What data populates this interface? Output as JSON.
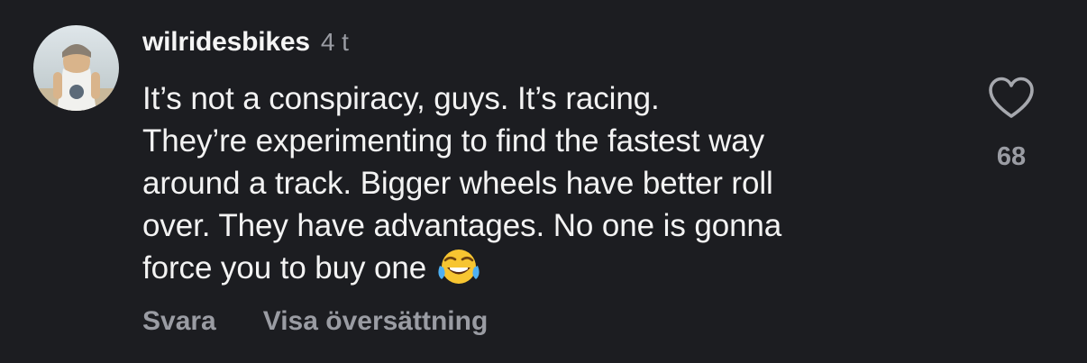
{
  "comment": {
    "username": "wilridesbikes",
    "time": "4 t",
    "text_lines": [
      "It’s not a conspiracy, guys. It’s racing.",
      "They’re experimenting to find the fastest way",
      "around a track. Bigger wheels have better roll",
      "over. They have advantages. No one is gonna",
      "force you to buy one"
    ],
    "emoji": "face-with-tears-of-joy",
    "like_count": "68",
    "actions": {
      "reply_label": "Svara",
      "translate_label": "Visa översättning"
    }
  },
  "colors": {
    "background": "#1c1d21",
    "primary_text": "#f3f3f3",
    "secondary_text": "#9a9ca3"
  },
  "icons": {
    "like": "heart-outline-icon"
  }
}
